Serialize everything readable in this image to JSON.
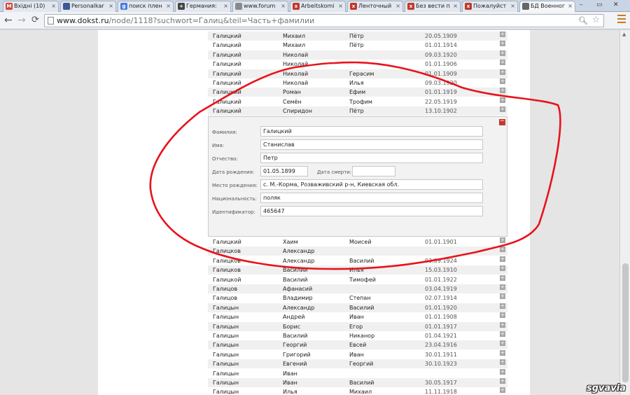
{
  "tabs": [
    {
      "label": "Вхідні (10)",
      "icon": "gmail-icon",
      "color": "#d14836",
      "glyph": "M"
    },
    {
      "label": "Personalkar",
      "icon": "page-icon",
      "color": "#3b5b92",
      "glyph": ""
    },
    {
      "label": "поиск плен",
      "icon": "google-icon",
      "color": "#4a7de0",
      "glyph": "g"
    },
    {
      "label": "Германия:",
      "icon": "cross-icon",
      "color": "#444444",
      "glyph": "+"
    },
    {
      "label": "www.forum",
      "icon": "page-icon",
      "color": "#8a8a8a",
      "glyph": ""
    },
    {
      "label": "Arbeitskomi",
      "icon": "x-icon",
      "color": "#c0392b",
      "glyph": "x"
    },
    {
      "label": "Ленточный",
      "icon": "x-icon",
      "color": "#c0392b",
      "glyph": "x"
    },
    {
      "label": "Без вести п",
      "icon": "x-icon",
      "color": "#c0392b",
      "glyph": "x"
    },
    {
      "label": "Пожалуйст",
      "icon": "x-icon",
      "color": "#c0392b",
      "glyph": "x"
    },
    {
      "label": "БД Военног",
      "icon": "page-icon",
      "color": "#666666",
      "glyph": ""
    }
  ],
  "url": {
    "host": "www.dokst.ru",
    "path": "/node/1118?suchwort=Галиц&teil=Часть+фамилии"
  },
  "rows_top": [
    [
      "Галицкий",
      "Михаил",
      "Пётр",
      "20.05.1909"
    ],
    [
      "Галицкий",
      "Михаил",
      "Пётр",
      "01.01.1914"
    ],
    [
      "Галицкий",
      "Николай",
      "",
      "09.03.1920"
    ],
    [
      "Галицкий",
      "Николай",
      "",
      "01.01.1906"
    ],
    [
      "Галицкий",
      "Николай",
      "Герасим",
      "01.01.1909"
    ],
    [
      "Галицкий",
      "Николай",
      "Илья",
      "09.03.1920"
    ],
    [
      "Галицкий",
      "Роман",
      "Ефим",
      "01.01.1919"
    ],
    [
      "Галицкий",
      "Семён",
      "Трофим",
      "22.05.1919"
    ],
    [
      "Галицкий",
      "Спиридон",
      "Пётр",
      "13.10.1902"
    ]
  ],
  "detail": {
    "surname_label": "Фамилия:",
    "surname": "Галицкий",
    "name_label": "Имя:",
    "name": "Станислав",
    "patronymic_label": "Отчество:",
    "patronymic": "Петр",
    "birth_label": "Дата рождения:",
    "birth": "01.05.1899",
    "death_label": "Дата смерти:",
    "death": "",
    "place_label": "Место рождения:",
    "place": "с. М.-Корма, Розваживский р-н, Киевская обл.",
    "nationality_label": "Национальность:",
    "nationality": "поляк",
    "id_label": "Идентификатор:",
    "id": "465647"
  },
  "rows_bottom": [
    [
      "Галицкий",
      "Хаим",
      "Моисей",
      "01.01.1901"
    ],
    [
      "Галицков",
      "Александр",
      "",
      ""
    ],
    [
      "Галицков",
      "Александр",
      "Василий",
      "03.09.1924"
    ],
    [
      "Галицков",
      "Василий",
      "Илья",
      "15.03.1910"
    ],
    [
      "Галицкой",
      "Василий",
      "Тимофей",
      "01.01.1922"
    ],
    [
      "Галицов",
      "Афанасий",
      "",
      "03.04.1919"
    ],
    [
      "Галицов",
      "Владимир",
      "Степан",
      "02.07.1914"
    ],
    [
      "Галицын",
      "Александр",
      "Василий",
      "01.01.1920"
    ],
    [
      "Галицын",
      "Андрей",
      "Иван",
      "01.01.1908"
    ],
    [
      "Галицын",
      "Борис",
      "Егор",
      "01.01.1917"
    ],
    [
      "Галицын",
      "Василий",
      "Никанор",
      "01.04.1921"
    ],
    [
      "Галицын",
      "Георгий",
      "Евсей",
      "23.04.1916"
    ],
    [
      "Галицын",
      "Григорий",
      "Иван",
      "30.01.1911"
    ],
    [
      "Галицын",
      "Евгений",
      "Георгий",
      "30.10.1923"
    ],
    [
      "Галицын",
      "Иван",
      "",
      ""
    ],
    [
      "Галицын",
      "Иван",
      "Василий",
      "30.05.1917"
    ],
    [
      "Галицын",
      "Илья",
      "Михаил",
      "11.11.1918"
    ]
  ],
  "watermark": "sgvavia",
  "colors": {
    "annotation": "#e8121b",
    "collapse": "#c0392b",
    "expand": "#a5a5a5"
  }
}
